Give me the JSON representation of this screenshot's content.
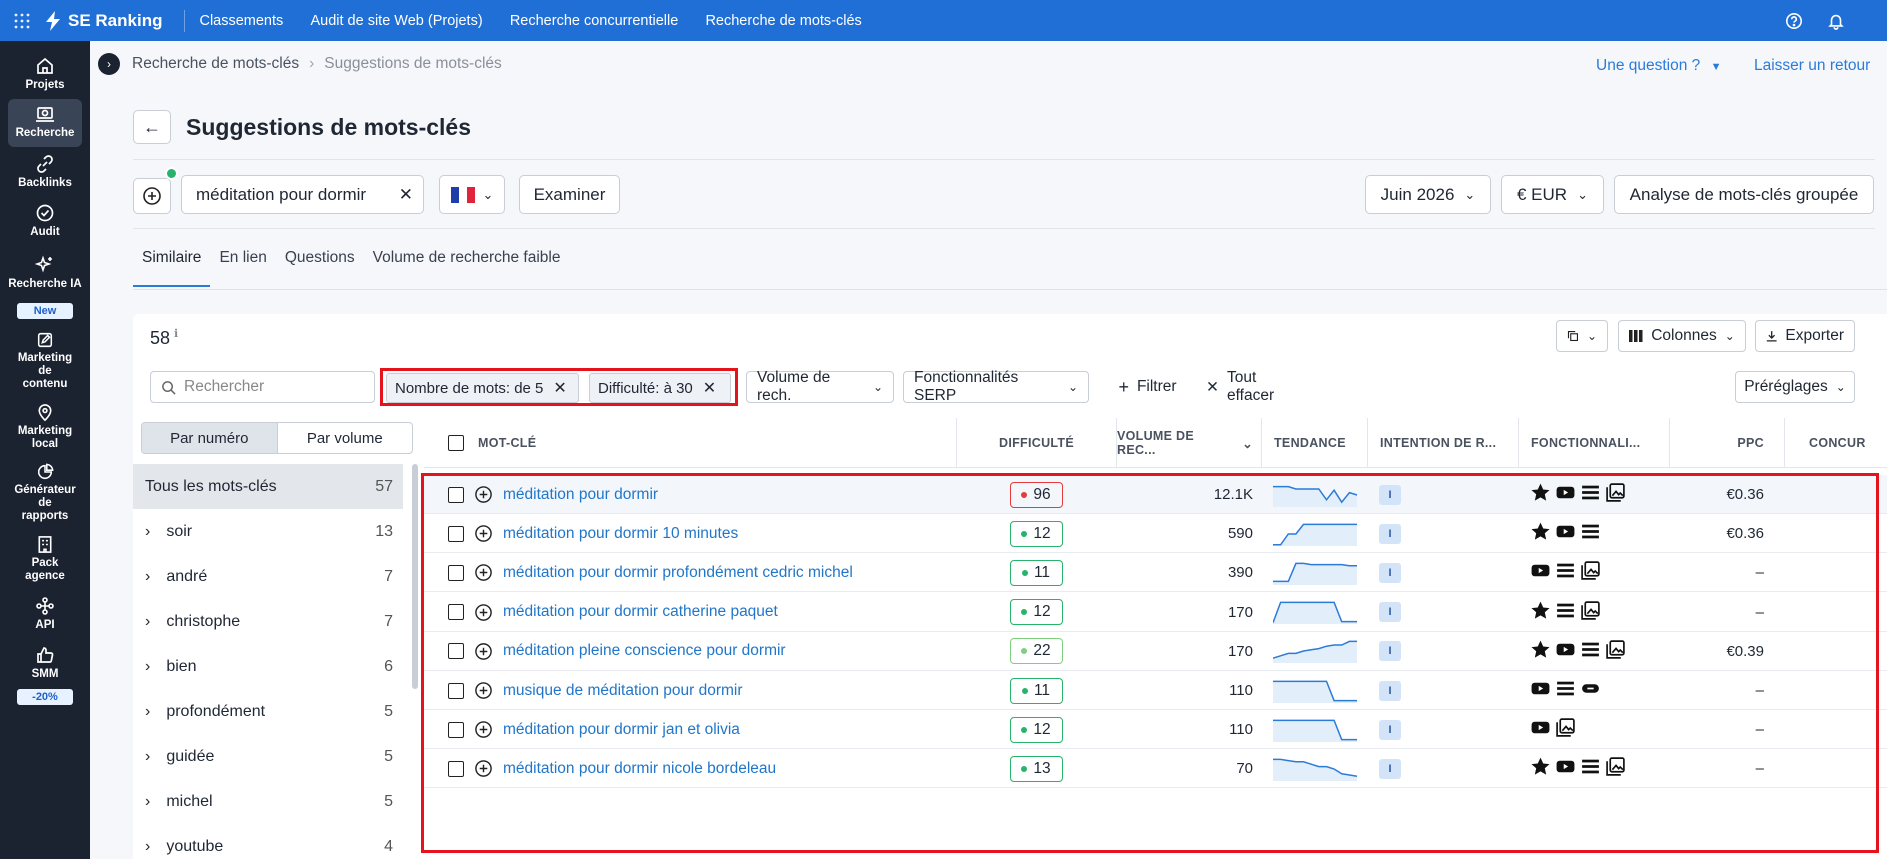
{
  "topbar": {
    "brand": "SE Ranking",
    "nav": [
      "Classements",
      "Audit de site Web (Projets)",
      "Recherche concurrentielle",
      "Recherche de mots-clés"
    ]
  },
  "sidebar": {
    "items": [
      {
        "label": "Projets",
        "icon": "home-icon"
      },
      {
        "label": "Recherche",
        "icon": "research-icon"
      },
      {
        "label": "Backlinks",
        "icon": "link-icon"
      },
      {
        "label": "Audit",
        "icon": "check-circle-icon"
      },
      {
        "label": "Recherche IA",
        "icon": "sparkle-icon",
        "badge": "New"
      },
      {
        "label": "Marketing de contenu",
        "icon": "edit-icon"
      },
      {
        "label": "Marketing local",
        "icon": "location-icon"
      },
      {
        "label": "Générateur de rapports",
        "icon": "pie-chart-icon"
      },
      {
        "label": "Pack agence",
        "icon": "building-icon"
      },
      {
        "label": "API",
        "icon": "api-icon"
      },
      {
        "label": "SMM",
        "icon": "thumbs-up-icon",
        "badge": "-20%"
      }
    ]
  },
  "breadcrumb": {
    "parent": "Recherche de mots-clés",
    "current": "Suggestions de mots-clés"
  },
  "header_links": {
    "question": "Une question ?",
    "feedback": "Laisser un retour"
  },
  "page_title": "Suggestions de mots-clés",
  "search": {
    "keyword": "méditation pour dormir",
    "country_flag": "FR",
    "examine_label": "Examiner",
    "month": "Juin 2026",
    "currency": "€ EUR",
    "group_analysis_label": "Analyse de mots-clés groupée"
  },
  "tabs": [
    "Similaire",
    "En lien",
    "Questions",
    "Volume de recherche faible"
  ],
  "table_controls": {
    "total": "58",
    "columns_label": "Colonnes",
    "export_label": "Exporter",
    "search_placeholder": "Rechercher",
    "chips": [
      "Nombre de mots: de 5",
      "Difficulté: à 30"
    ],
    "volume_filter": "Volume de rech.",
    "serp_filter": "Fonctionnalités SERP",
    "filter_label": "Filtrer",
    "clear_label": "Tout effacer",
    "presets_label": "Préréglages"
  },
  "group_toggle": [
    "Par numéro",
    "Par volume"
  ],
  "groups": [
    {
      "name": "Tous les mots-clés",
      "count": "57"
    },
    {
      "name": "soir",
      "count": "13"
    },
    {
      "name": "andré",
      "count": "7"
    },
    {
      "name": "christophe",
      "count": "7"
    },
    {
      "name": "bien",
      "count": "6"
    },
    {
      "name": "profondément",
      "count": "5"
    },
    {
      "name": "guidée",
      "count": "5"
    },
    {
      "name": "michel",
      "count": "5"
    },
    {
      "name": "youtube",
      "count": "4"
    }
  ],
  "columns": [
    "MOT-CLÉ",
    "DIFFICULTÉ",
    "VOLUME DE REC...",
    "TENDANCE",
    "INTENTION DE R...",
    "FONCTIONNALI...",
    "PPC",
    "CONCUR"
  ],
  "colors": {
    "accent": "#1f6fd6",
    "link": "#2176c9",
    "red": "#e5141c",
    "green": "#27b36a",
    "lightgreen": "#7ed07e"
  },
  "rows": [
    {
      "keyword": "méditation pour dormir",
      "difficulty": "96",
      "diff_level": "high",
      "volume": "12.1K",
      "intent": "I",
      "features": [
        "star",
        "youtube",
        "list",
        "image"
      ],
      "ppc": "€0.36",
      "trend": [
        0.85,
        0.85,
        0.85,
        0.75,
        0.75,
        0.75,
        0.75,
        0.3,
        0.7,
        0.2,
        0.6,
        0.5
      ]
    },
    {
      "keyword": "méditation pour dormir 10 minutes",
      "difficulty": "12",
      "diff_level": "low",
      "volume": "590",
      "intent": "I",
      "features": [
        "star",
        "youtube",
        "list"
      ],
      "ppc": "€0.36",
      "trend": [
        0.05,
        0.05,
        0.5,
        0.5,
        0.9,
        0.9,
        0.9,
        0.9,
        0.9,
        0.9,
        0.9,
        0.9
      ]
    },
    {
      "keyword": "méditation pour dormir profondément cedric michel",
      "difficulty": "11",
      "diff_level": "low",
      "volume": "390",
      "intent": "I",
      "features": [
        "youtube",
        "list",
        "image"
      ],
      "ppc": "–",
      "trend": [
        0.15,
        0.15,
        0.15,
        0.9,
        0.9,
        0.85,
        0.85,
        0.85,
        0.85,
        0.85,
        0.8,
        0.8
      ]
    },
    {
      "keyword": "méditation pour dormir catherine paquet",
      "difficulty": "12",
      "diff_level": "low",
      "volume": "170",
      "intent": "I",
      "features": [
        "star",
        "list",
        "image"
      ],
      "ppc": "–",
      "trend": [
        0.05,
        0.9,
        0.9,
        0.9,
        0.9,
        0.9,
        0.9,
        0.9,
        0.9,
        0.1,
        0.1,
        0.1
      ]
    },
    {
      "keyword": "méditation pleine conscience pour dormir",
      "difficulty": "22",
      "diff_level": "mid",
      "volume": "170",
      "intent": "I",
      "features": [
        "star",
        "youtube",
        "list",
        "image"
      ],
      "ppc": "€0.39",
      "trend": [
        0.2,
        0.3,
        0.4,
        0.4,
        0.5,
        0.55,
        0.6,
        0.7,
        0.75,
        0.75,
        0.9,
        0.9
      ]
    },
    {
      "keyword": "musique de méditation pour dormir",
      "difficulty": "11",
      "diff_level": "low",
      "volume": "110",
      "intent": "I",
      "features": [
        "youtube",
        "list",
        "link"
      ],
      "ppc": "–",
      "trend": [
        0.9,
        0.9,
        0.9,
        0.9,
        0.9,
        0.9,
        0.9,
        0.9,
        0.1,
        0.1,
        0.1,
        0.1
      ]
    },
    {
      "keyword": "méditation pour dormir jan et olivia",
      "difficulty": "12",
      "diff_level": "low",
      "volume": "110",
      "intent": "I",
      "features": [
        "youtube",
        "image"
      ],
      "ppc": "–",
      "trend": [
        0.9,
        0.9,
        0.9,
        0.9,
        0.9,
        0.9,
        0.9,
        0.9,
        0.9,
        0.1,
        0.1,
        0.1
      ]
    },
    {
      "keyword": "méditation pour dormir nicole bordeleau",
      "difficulty": "13",
      "diff_level": "low",
      "volume": "70",
      "intent": "I",
      "features": [
        "star",
        "youtube",
        "list",
        "image"
      ],
      "ppc": "–",
      "trend": [
        0.9,
        0.9,
        0.85,
        0.8,
        0.8,
        0.7,
        0.6,
        0.6,
        0.5,
        0.3,
        0.25,
        0.2
      ]
    }
  ]
}
